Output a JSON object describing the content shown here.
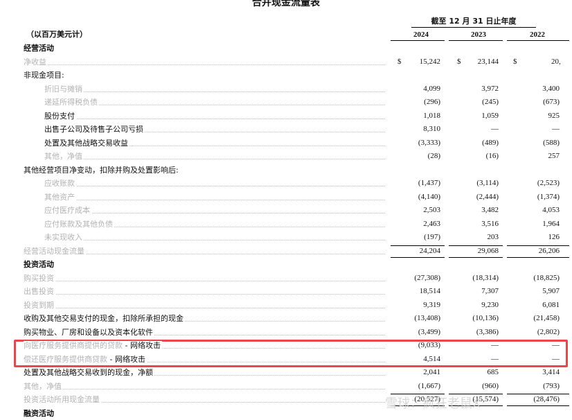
{
  "title": "合并现金流量表",
  "period_header": "截至 12 月 31 日止年度",
  "unit_label": "（以百万美元计）",
  "years": [
    "2024",
    "2023",
    "2022"
  ],
  "currency_symbol": "$",
  "watermark": "雪球：疯狂老鼠X",
  "highlight_color": "#e8474d",
  "rows": [
    {
      "label": "经营活动",
      "style": "section",
      "values": [
        "",
        "",
        ""
      ]
    },
    {
      "label": "净收益",
      "style": "muted",
      "values": [
        "15,242",
        "23,144",
        "20,"
      ],
      "dollar": true
    },
    {
      "label": "非现金项目:",
      "style": "plain",
      "values": [
        "",
        "",
        ""
      ]
    },
    {
      "label": "折旧与摊销",
      "style": "muted-indent",
      "values": [
        "4,099",
        "3,972",
        "3,400"
      ]
    },
    {
      "label": "递延所得税负债",
      "style": "muted-indent",
      "values": [
        "(296)",
        "(245)",
        "(673)"
      ]
    },
    {
      "label": "股份支付",
      "style": "indent",
      "values": [
        "1,018",
        "1,059",
        "925"
      ]
    },
    {
      "label": "出售子公司及待售子公司亏损",
      "style": "indent",
      "values": [
        "8,310",
        "—",
        "—"
      ]
    },
    {
      "label": "处置及其他战略交易收益",
      "style": "indent",
      "values": [
        "(3,333)",
        "(489)",
        "(588)"
      ]
    },
    {
      "label": "其他，净值",
      "style": "muted-indent",
      "values": [
        "(28)",
        "(16)",
        "257"
      ]
    },
    {
      "label": "其他经营项目净变动，扣除并购及处置影响后:",
      "style": "plain",
      "values": [
        "",
        "",
        ""
      ]
    },
    {
      "label": "应收账款",
      "style": "muted-indent",
      "values": [
        "(1,437)",
        "(3,114)",
        "(2,523)"
      ]
    },
    {
      "label": "其他资产",
      "style": "muted-indent",
      "values": [
        "(4,140)",
        "(2,444)",
        "(1,374)"
      ]
    },
    {
      "label": "应付医疗成本",
      "style": "muted-indent",
      "values": [
        "2,503",
        "3,482",
        "4,053"
      ]
    },
    {
      "label": "应付账款及其他负债",
      "style": "muted-indent",
      "values": [
        "2,463",
        "3,516",
        "1,964"
      ]
    },
    {
      "label": "未实现收入",
      "style": "muted-indent",
      "values": [
        "(197)",
        "203",
        "126"
      ]
    },
    {
      "label": "经营活动现金流量",
      "style": "muted",
      "values": [
        "24,204",
        "29,068",
        "26,206"
      ]
    },
    {
      "label": "投资活动",
      "style": "section",
      "values": [
        "",
        "",
        ""
      ]
    },
    {
      "label": "购买投资",
      "style": "muted",
      "values": [
        "(27,308)",
        "(18,314)",
        "(18,825)"
      ]
    },
    {
      "label": "出售投资",
      "style": "muted",
      "values": [
        "18,514",
        "7,307",
        "5,907"
      ]
    },
    {
      "label": "投资到期",
      "style": "muted",
      "values": [
        "9,319",
        "9,230",
        "6,081"
      ]
    },
    {
      "label": "收购及其他交易支付的现金，扣除所承担的现金",
      "style": "plain",
      "values": [
        "(13,408)",
        "(10,136)",
        "(21,458)"
      ]
    },
    {
      "label": "购买物业、厂房和设备以及资本化软件",
      "style": "plain",
      "values": [
        "(3,499)",
        "(3,386)",
        "(2,802)"
      ]
    },
    {
      "label": "向医疗服务提供商提供的贷款 - 网络攻击",
      "style": "mixed",
      "muted_part": "向医疗服务提供商提供的贷款",
      "plain_part": " - 网络攻击",
      "values": [
        "(9,033)",
        "—",
        "—"
      ]
    },
    {
      "label": "偿还医疗服务提供商贷款 - 网络攻击",
      "style": "mixed",
      "muted_part": "偿还医疗服务提供商贷款",
      "plain_part": " - 网络攻击",
      "values": [
        "4,514",
        "—",
        "—"
      ]
    },
    {
      "label": "处置及其他战略交易收到的现金，净额",
      "style": "plain",
      "values": [
        "2,041",
        "685",
        "3,414"
      ]
    },
    {
      "label": "其他，净值",
      "style": "muted",
      "values": [
        "(1,667)",
        "(960)",
        "(793)"
      ]
    },
    {
      "label": "投资活动所用现金流量",
      "style": "muted",
      "values": [
        "(20,527)",
        "(15,574)",
        "(28,476)"
      ]
    },
    {
      "label": "融资活动",
      "style": "section",
      "values": [
        "",
        "",
        ""
      ]
    }
  ]
}
